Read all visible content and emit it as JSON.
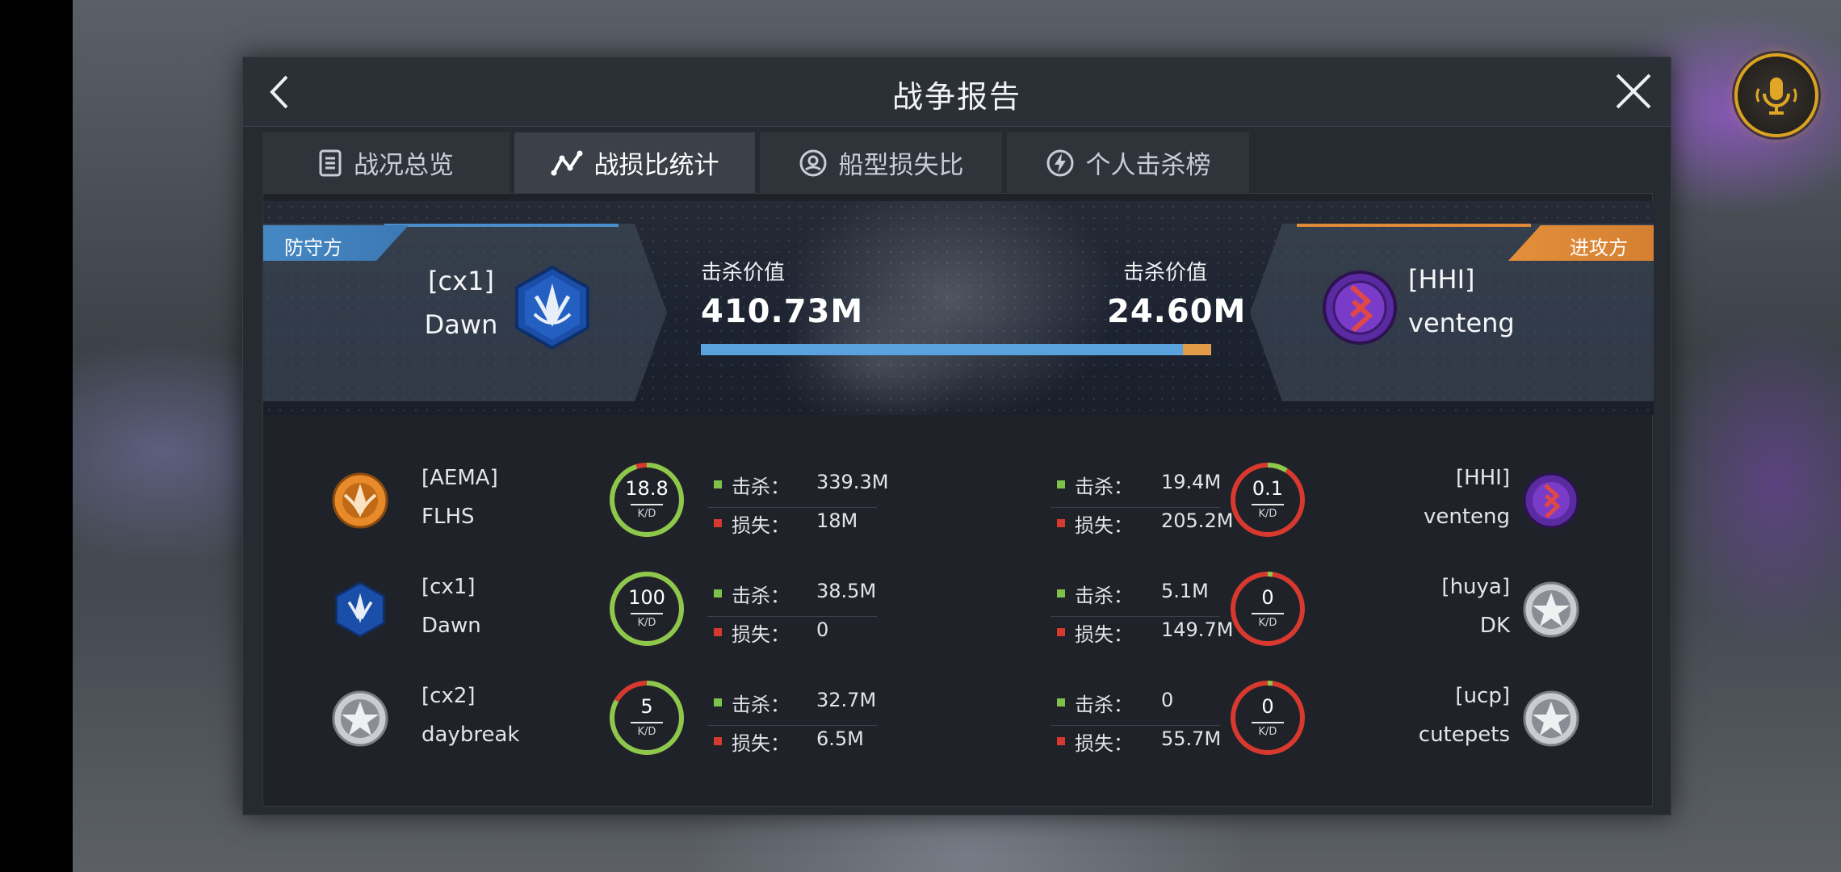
{
  "header": {
    "title": "战争报告"
  },
  "tabs": [
    {
      "label": "战况总览",
      "icon": "document-icon",
      "active": false
    },
    {
      "label": "战损比统计",
      "icon": "chart-line-icon",
      "active": true
    },
    {
      "label": "船型损失比",
      "icon": "ship-icon",
      "active": false
    },
    {
      "label": "个人击杀榜",
      "icon": "lightning-icon",
      "active": false
    }
  ],
  "defender": {
    "side_label": "防守方",
    "tag": "[cx1]",
    "name": "Dawn",
    "kill_value_label": "击杀价值",
    "kill_value": "410.73M",
    "color": "#4a8fcb"
  },
  "attacker": {
    "side_label": "进攻方",
    "tag": "[HHI]",
    "name": "venteng",
    "kill_value_label": "击杀价值",
    "kill_value": "24.60M",
    "color": "#de8a38"
  },
  "kill_value_ratio": {
    "defender_fraction": 0.944
  },
  "labels": {
    "kill": "击杀：",
    "loss": "损失：",
    "kd": "K/D"
  },
  "rows": [
    {
      "left": {
        "tag": "[AEMA]",
        "name": "FLHS",
        "kd": "18.8",
        "kd_fraction": 0.95,
        "kill": "339.3M",
        "loss": "18M",
        "logo": "orange-emblem"
      },
      "right": {
        "tag": "[HHI]",
        "name": "venteng",
        "kd": "0.1",
        "kd_fraction": 0.09,
        "kill": "19.4M",
        "loss": "205.2M",
        "logo": "purple-emblem"
      }
    },
    {
      "left": {
        "tag": "[cx1]",
        "name": "Dawn",
        "kd": "100",
        "kd_fraction": 1.0,
        "kill": "38.5M",
        "loss": "0",
        "logo": "blue-emblem"
      },
      "right": {
        "tag": "[huya]",
        "name": "DK",
        "kd": "0",
        "kd_fraction": 0.0,
        "kill": "5.1M",
        "loss": "149.7M",
        "logo": "star-emblem"
      }
    },
    {
      "left": {
        "tag": "[cx2]",
        "name": "daybreak",
        "kd": "5",
        "kd_fraction": 0.83,
        "kill": "32.7M",
        "loss": "6.5M",
        "logo": "star-emblem"
      },
      "right": {
        "tag": "[ucp]",
        "name": "cutepets",
        "kd": "0",
        "kd_fraction": 0.0,
        "kill": "0",
        "loss": "55.7M",
        "logo": "star-emblem"
      }
    }
  ],
  "colors": {
    "kd_good": "#8cc84b",
    "kd_bad": "#d8392e",
    "mic_ring": "#d9a220"
  }
}
